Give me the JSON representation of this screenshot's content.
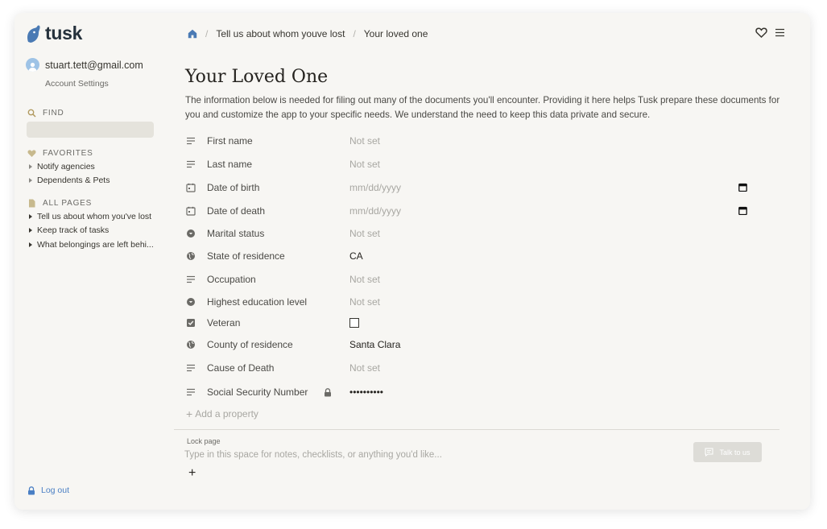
{
  "brand": {
    "name": "tusk"
  },
  "account": {
    "email": "stuart.tett@gmail.com",
    "settings_label": "Account Settings"
  },
  "sidebar": {
    "find_label": "FIND",
    "favorites_label": "FAVORITES",
    "favorites": [
      {
        "label": "Notify agencies"
      },
      {
        "label": "Dependents & Pets"
      }
    ],
    "all_pages_label": "ALL PAGES",
    "pages": [
      {
        "label": "Tell us about whom you've lost"
      },
      {
        "label": "Keep track of tasks"
      },
      {
        "label": "What belongings are left behi..."
      }
    ],
    "logout_label": "Log out"
  },
  "breadcrumb": {
    "items": [
      {
        "label": "Tell us about whom youve lost"
      },
      {
        "label": "Your loved one"
      }
    ]
  },
  "page": {
    "title": "Your Loved One",
    "intro": "The information below is needed for filing out many of the documents you'll encounter. Providing it here helps Tusk prepare these documents for you and customize the app to your specific needs. We understand the need to keep this data private and secure."
  },
  "properties": [
    {
      "label": "First name",
      "icon": "text-lines-icon",
      "value": "Not set"
    },
    {
      "label": "Last name",
      "icon": "text-lines-icon",
      "value": "Not set"
    },
    {
      "label": "Date of birth",
      "icon": "calendar-icon",
      "value": "mm/dd/yyyy"
    },
    {
      "label": "Date of death",
      "icon": "calendar-icon",
      "value": "mm/dd/yyyy"
    },
    {
      "label": "Marital status",
      "icon": "select-icon",
      "value": "Not set"
    },
    {
      "label": "State of residence",
      "icon": "globe-icon",
      "value": "CA"
    },
    {
      "label": "Occupation",
      "icon": "text-lines-icon",
      "value": "Not set"
    },
    {
      "label": "Highest education level",
      "icon": "select-icon",
      "value": "Not set"
    },
    {
      "label": "Veteran",
      "icon": "checkbox-icon",
      "checked": false
    },
    {
      "label": "County of residence",
      "icon": "globe-icon",
      "value": "Santa Clara"
    },
    {
      "label": "Cause of Death",
      "icon": "text-lines-icon",
      "value": "Not set"
    },
    {
      "label": "Social Security Number",
      "icon": "text-lines-icon",
      "value": "••••••••••",
      "locked": true
    }
  ],
  "add_property_label": "Add a property",
  "lock_page_label": "Lock page",
  "notes_placeholder": "Type in this space for notes, checklists, or anything you'd like...",
  "add_block_label": "+",
  "talk_button_label": "Talk to us"
}
